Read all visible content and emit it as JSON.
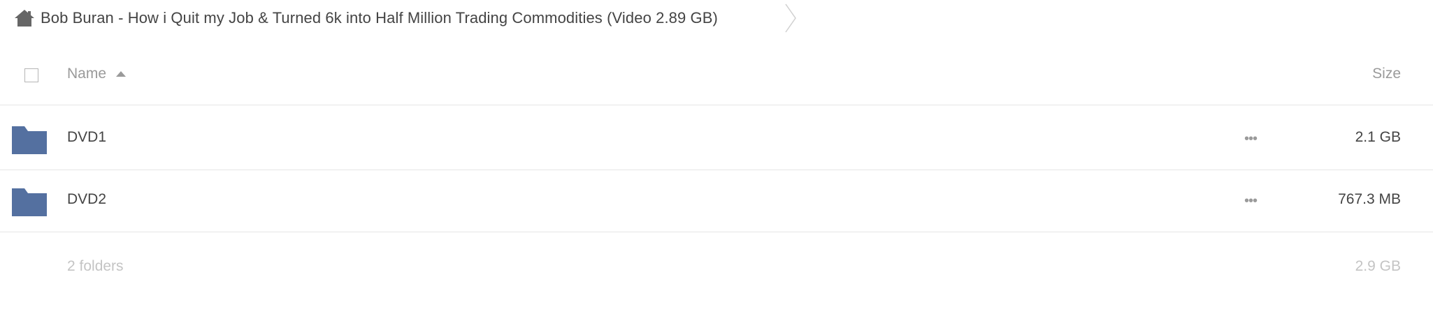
{
  "breadcrumb": {
    "home_icon": "home-icon",
    "current": "Bob Buran - How i Quit my Job & Turned 6k into Half Million Trading Commodities (Video 2.89 GB)"
  },
  "table": {
    "columns": {
      "name": "Name",
      "size": "Size"
    },
    "sort": "name-ascending",
    "rows": [
      {
        "icon": "folder-icon",
        "name": "DVD1",
        "menu": "•••",
        "size": "2.1 GB"
      },
      {
        "icon": "folder-icon",
        "name": "DVD2",
        "menu": "•••",
        "size": "767.3 MB"
      }
    ],
    "summary": {
      "count": "2 folders",
      "size": "2.9 GB"
    }
  },
  "colors": {
    "folder": "#5470a0",
    "home": "#666666",
    "muted": "#9a9a9a",
    "divider": "#e6e6e6"
  }
}
